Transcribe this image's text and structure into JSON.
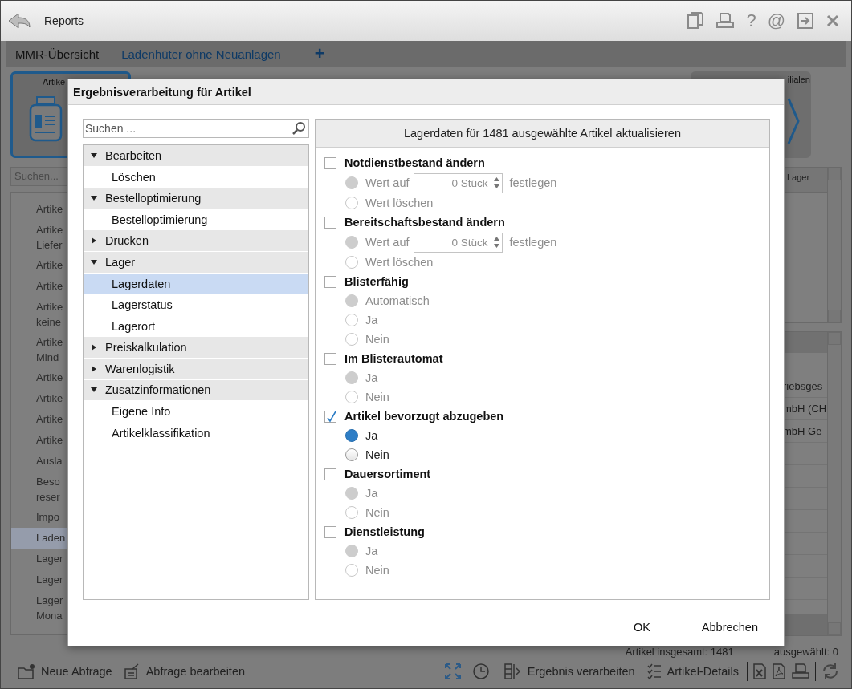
{
  "window": {
    "title": "Reports"
  },
  "title_bar_buttons": [
    {
      "kind": "copy"
    },
    {
      "kind": "print"
    },
    {
      "kind": "glyph",
      "label": "?"
    },
    {
      "kind": "glyph",
      "label": "@"
    },
    {
      "kind": "export"
    },
    {
      "kind": "close"
    }
  ],
  "tabs": [
    {
      "label": "MMR-Übersicht",
      "selected": true
    },
    {
      "label": "Ladenhüter ohne Neuanlagen",
      "selected": false
    }
  ],
  "add_tab": "+",
  "tiles": [
    {
      "label": "Artike",
      "kind": "bottle",
      "selected": true
    },
    {
      "label": "ilialen",
      "kind": "chevron",
      "selected": false
    }
  ],
  "background_list": {
    "search_placeholder": "Suchen...",
    "items": [
      {
        "lines": [
          "Artike"
        ],
        "selected": false
      },
      {
        "lines": [
          "Artike",
          "Liefer"
        ],
        "selected": false
      },
      {
        "lines": [
          "Artike"
        ],
        "selected": false
      },
      {
        "lines": [
          "Artike"
        ],
        "selected": false
      },
      {
        "lines": [
          "Artike",
          "keine"
        ],
        "selected": false
      },
      {
        "lines": [
          "Artike",
          "Mind"
        ],
        "selected": false
      },
      {
        "lines": [
          "Artike"
        ],
        "selected": false
      },
      {
        "lines": [
          "Artike"
        ],
        "selected": false
      },
      {
        "lines": [
          "Artike"
        ],
        "selected": false
      },
      {
        "lines": [
          "Artike"
        ],
        "selected": false
      },
      {
        "lines": [
          "Ausla"
        ],
        "selected": false
      },
      {
        "lines": [
          "Beso",
          "reser"
        ],
        "selected": false
      },
      {
        "lines": [
          "Impo"
        ],
        "selected": false
      },
      {
        "lines": [
          "Laden"
        ],
        "selected": true
      },
      {
        "lines": [
          "Lager"
        ],
        "selected": false
      },
      {
        "lines": [
          "Lager"
        ],
        "selected": false
      },
      {
        "lines": [
          "Lager",
          "Mona"
        ],
        "selected": false
      }
    ]
  },
  "background_table": {
    "column_header": "Lager",
    "rows": [
      "riebsges",
      "mbH (CH",
      "mbH Ge"
    ]
  },
  "status": {
    "total": "Artikel insgesamt: 1481",
    "selected_count": "ausgewählt: 0"
  },
  "toolbar": {
    "left": [
      {
        "kind": "new",
        "label": "Neue Abfrage"
      },
      {
        "kind": "edit",
        "label": "Abfrage bearbeiten"
      }
    ],
    "right": [
      {
        "kind": "expand"
      },
      {
        "kind": "separator"
      },
      {
        "kind": "clock"
      },
      {
        "kind": "separator"
      },
      {
        "kind": "process",
        "label": "Ergebnis verarbeiten"
      },
      {
        "kind": "details",
        "label": "Artikel-Details"
      },
      {
        "kind": "separator"
      },
      {
        "kind": "excel"
      },
      {
        "kind": "pdf"
      },
      {
        "kind": "print"
      },
      {
        "kind": "separator"
      },
      {
        "kind": "refresh"
      }
    ]
  },
  "dialog": {
    "title": "Ergebnisverarbeitung für Artikel",
    "search_placeholder": "Suchen ...",
    "tree": [
      {
        "label": "Bearbeiten",
        "expanded": true,
        "children": [
          {
            "label": "Löschen",
            "selected": false
          }
        ]
      },
      {
        "label": "Bestelloptimierung",
        "expanded": true,
        "children": [
          {
            "label": "Bestelloptimierung",
            "selected": false
          }
        ]
      },
      {
        "label": "Drucken",
        "expanded": false
      },
      {
        "label": "Lager",
        "expanded": true,
        "children": [
          {
            "label": "Lagerdaten",
            "selected": true
          },
          {
            "label": "Lagerstatus",
            "selected": false
          },
          {
            "label": "Lagerort",
            "selected": false
          }
        ]
      },
      {
        "label": "Preiskalkulation",
        "expanded": false
      },
      {
        "label": "Warenlogistik",
        "expanded": false
      },
      {
        "label": "Zusatzinformationen",
        "expanded": true,
        "children": [
          {
            "label": "Eigene Info",
            "selected": false
          },
          {
            "label": "Artikelklassifikation",
            "selected": false
          }
        ]
      }
    ],
    "panel": {
      "title": "Lagerdaten für 1481 ausgewählte Artikel aktualisieren",
      "sections": [
        {
          "label": "Notdienstbestand ändern",
          "checked": false,
          "options": [
            {
              "kind": "value",
              "label": "Wert auf",
              "value": "0",
              "unit": "Stück",
              "suffix": "festlegen",
              "selected": true
            },
            {
              "kind": "plain",
              "label": "Wert löschen",
              "selected": false
            }
          ]
        },
        {
          "label": "Bereitschaftsbestand ändern",
          "checked": false,
          "options": [
            {
              "kind": "value",
              "label": "Wert auf",
              "value": "0",
              "unit": "Stück",
              "suffix": "festlegen",
              "selected": true
            },
            {
              "kind": "plain",
              "label": "Wert löschen",
              "selected": false
            }
          ]
        },
        {
          "label": "Blisterfähig",
          "checked": false,
          "options": [
            {
              "kind": "plain",
              "label": "Automatisch",
              "selected": true
            },
            {
              "kind": "plain",
              "label": "Ja",
              "selected": false
            },
            {
              "kind": "plain",
              "label": "Nein",
              "selected": false
            }
          ]
        },
        {
          "label": "Im Blisterautomat",
          "checked": false,
          "options": [
            {
              "kind": "plain",
              "label": "Ja",
              "selected": true
            },
            {
              "kind": "plain",
              "label": "Nein",
              "selected": false
            }
          ]
        },
        {
          "label": "Artikel bevorzugt abzugeben",
          "checked": true,
          "options": [
            {
              "kind": "plain",
              "label": "Ja",
              "selected": true
            },
            {
              "kind": "plain",
              "label": "Nein",
              "selected": false
            }
          ]
        },
        {
          "label": "Dauersortiment",
          "checked": false,
          "options": [
            {
              "kind": "plain",
              "label": "Ja",
              "selected": true
            },
            {
              "kind": "plain",
              "label": "Nein",
              "selected": false
            }
          ]
        },
        {
          "label": "Dienstleistung",
          "checked": false,
          "options": [
            {
              "kind": "plain",
              "label": "Ja",
              "selected": true
            },
            {
              "kind": "plain",
              "label": "Nein",
              "selected": false
            }
          ]
        }
      ]
    },
    "buttons": [
      "OK",
      "Abbrechen"
    ]
  }
}
